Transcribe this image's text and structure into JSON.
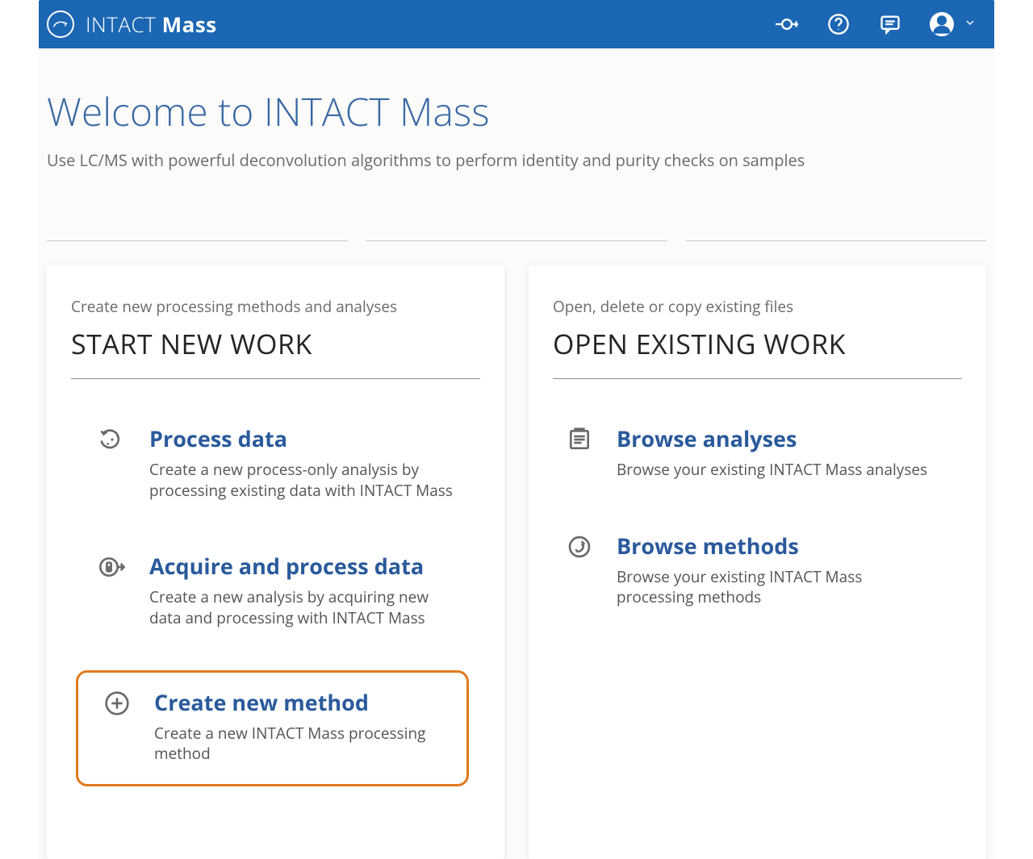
{
  "header": {
    "brand_first": "INTACT",
    "brand_second": "Mass"
  },
  "welcome": {
    "title": "Welcome to INTACT Mass",
    "subtitle": "Use LC/MS with powerful deconvolution algorithms to perform identity and purity checks on samples"
  },
  "cards": {
    "left": {
      "pre": "Create new processing methods and analyses",
      "title": "START NEW WORK",
      "actions": {
        "process": {
          "title": "Process data",
          "desc": "Create a new process-only analysis by processing existing data with INTACT Mass"
        },
        "acquire": {
          "title": "Acquire and process data",
          "desc": "Create a new analysis by acquiring new data and processing with INTACT Mass"
        },
        "newmethod": {
          "title": "Create new method",
          "desc": "Create a new INTACT Mass processing method"
        }
      }
    },
    "right": {
      "pre": "Open, delete or copy existing files",
      "title": "OPEN EXISTING WORK",
      "actions": {
        "browse_analyses": {
          "title": "Browse analyses",
          "desc": "Browse your existing INTACT Mass analyses"
        },
        "browse_methods": {
          "title": "Browse methods",
          "desc": "Browse your existing INTACT Mass processing methods"
        }
      }
    }
  }
}
